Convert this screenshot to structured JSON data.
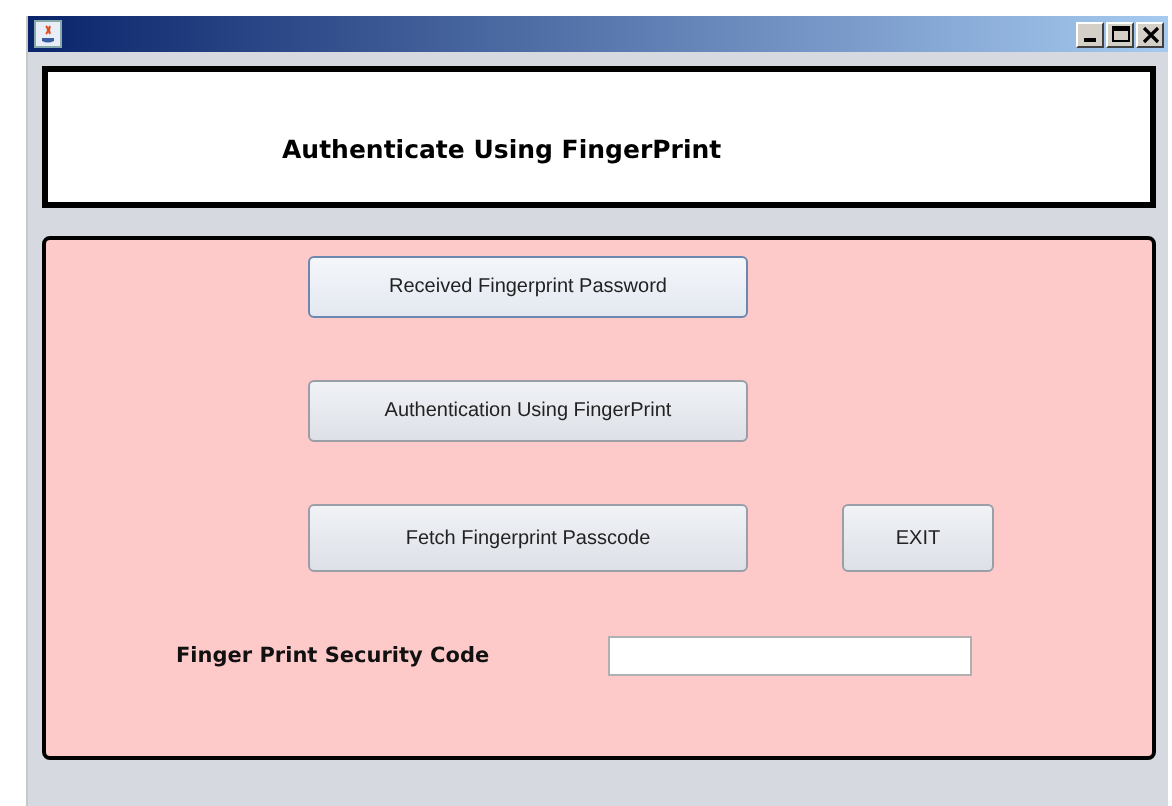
{
  "header": {
    "title": "Authenticate Using FingerPrint"
  },
  "buttons": [
    {
      "label": "Received Fingerprint Password",
      "focused": true
    },
    {
      "label": "Authentication Using FingerPrint",
      "focused": false
    },
    {
      "label": "Fetch Fingerprint Passcode",
      "focused": false
    }
  ],
  "exit_button": {
    "label": "EXIT"
  },
  "security_code": {
    "label": "Finger Print Security Code"
  }
}
